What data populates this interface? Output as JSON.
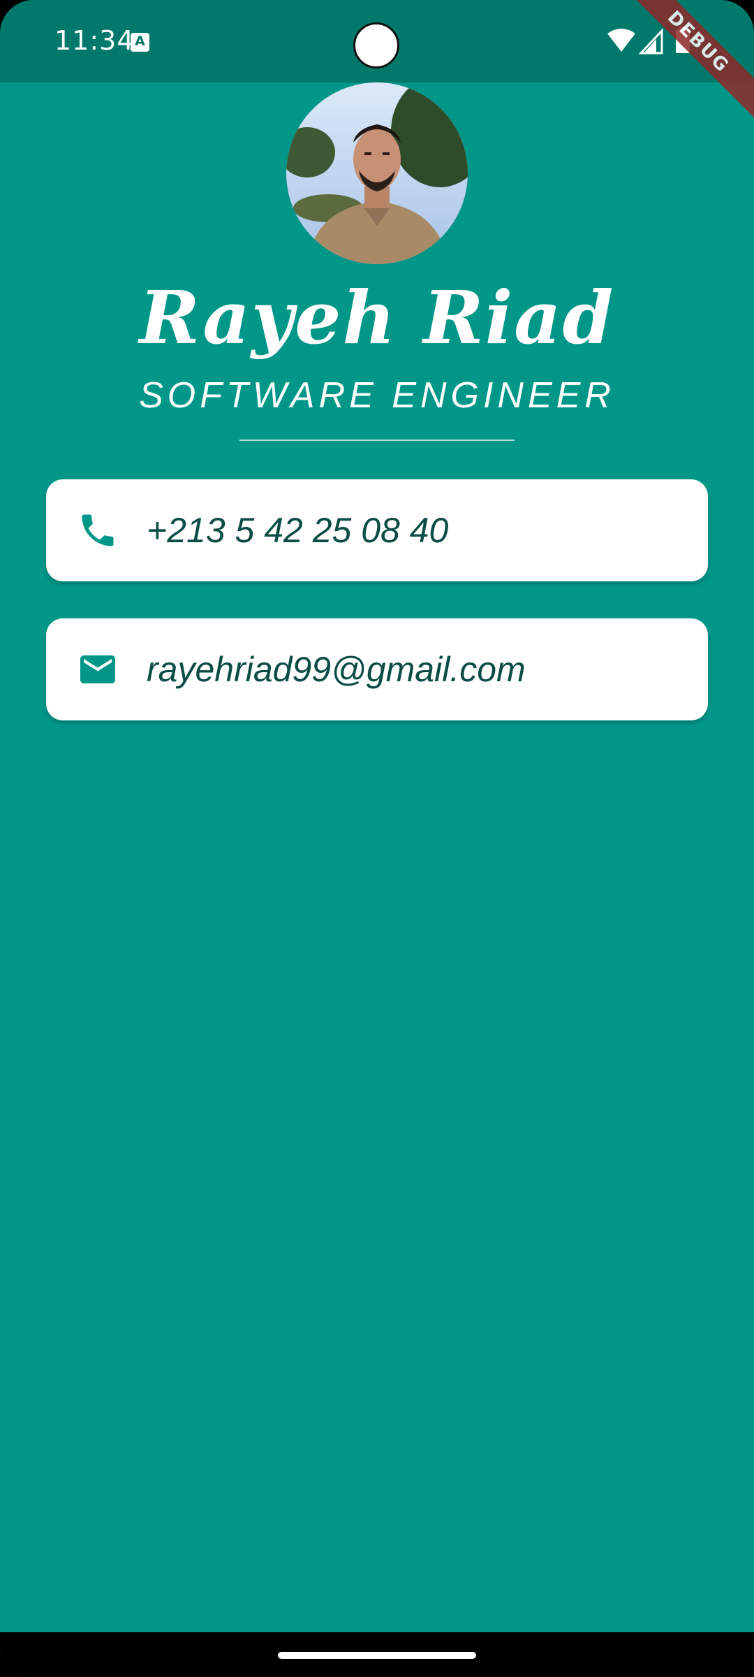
{
  "status_bar": {
    "time": "11:34",
    "notification_icon": "a-icon",
    "notification_letter": "A",
    "wifi_icon": "wifi-icon",
    "signal_icon": "signal-icon",
    "battery_icon": "battery-icon"
  },
  "debug_banner": "DEBUG",
  "profile": {
    "avatar_icon": "profile-photo",
    "name": "Rayeh Riad",
    "title": "SOFTWARE ENGINEER"
  },
  "contacts": {
    "phone": {
      "icon": "phone-icon",
      "value": "+213 5 42 25 08 40"
    },
    "email": {
      "icon": "mail-icon",
      "value": "rayehriad99@gmail.com"
    }
  },
  "colors": {
    "background": "#009688",
    "status_bar": "#00796B",
    "card": "#FFFFFF",
    "card_text": "#0B4D45",
    "icon": "#009688",
    "debug_banner": "#8E2A2A"
  }
}
